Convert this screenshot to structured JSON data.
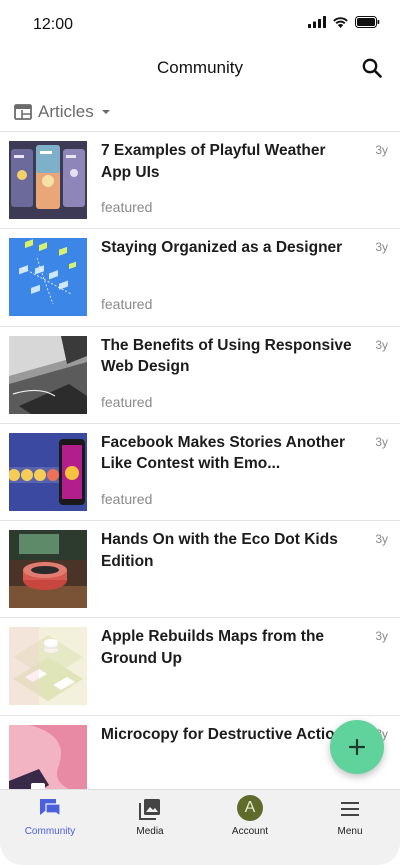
{
  "status_bar": {
    "time": "12:00"
  },
  "header": {
    "title": "Community"
  },
  "filter": {
    "label": "Articles"
  },
  "articles": [
    {
      "title": "7 Examples of Playful Weather App UIs",
      "tag": "featured",
      "age": "3y"
    },
    {
      "title": "Staying Organized as a Designer",
      "tag": "featured",
      "age": "3y"
    },
    {
      "title": "The Benefits of Using Responsive Web Design",
      "tag": "featured",
      "age": "3y"
    },
    {
      "title": "Facebook Makes Stories Another Like Contest with Emo...",
      "tag": "featured",
      "age": "3y"
    },
    {
      "title": "Hands On with the Eco Dot Kids Edition",
      "tag": "",
      "age": "3y"
    },
    {
      "title": "Apple Rebuilds Maps from the Ground Up",
      "tag": "",
      "age": "3y"
    },
    {
      "title": "Microcopy for Destructive Actions",
      "tag": "",
      "age": "3y"
    }
  ],
  "fab": {
    "icon": "plus-icon"
  },
  "bottom_nav": {
    "items": [
      {
        "label": "Community",
        "icon": "chat-icon",
        "active": true
      },
      {
        "label": "Media",
        "icon": "image-icon",
        "active": false
      },
      {
        "label": "Account",
        "icon": "avatar",
        "avatar_letter": "A",
        "active": false
      },
      {
        "label": "Menu",
        "icon": "menu-icon",
        "active": false
      }
    ]
  },
  "colors": {
    "accent": "#4a61dd",
    "fab": "#5fd39b",
    "avatar": "#5e6b2a"
  }
}
